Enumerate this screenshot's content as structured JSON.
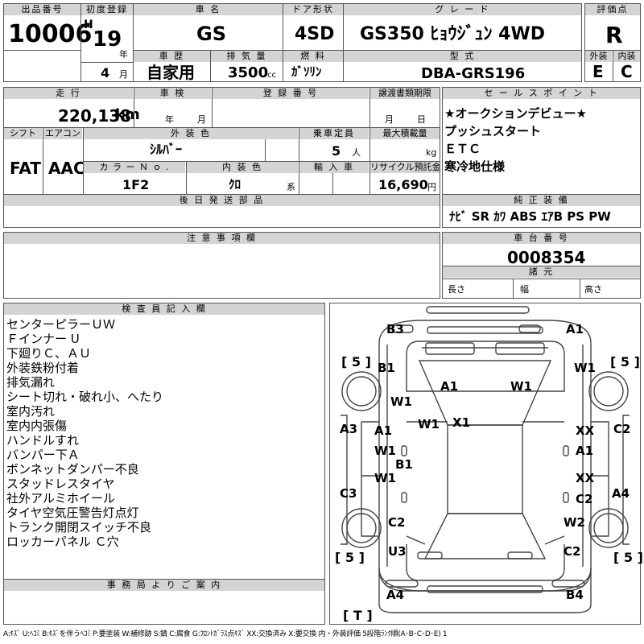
{
  "header": {
    "lot_no_label": "出品番号",
    "lot_no": "10006",
    "first_reg_label": "初度登録",
    "era": "H",
    "year": "19",
    "year_unit": "年",
    "month": "4",
    "month_unit": "月",
    "car_name_label": "車 名",
    "car_name": "GS",
    "door_label": "ドア形状",
    "door": "4SD",
    "grade_label": "グ レ ー ド",
    "grade": "GS350 ﾋｮｳｼﾞｭﾝ 4WD",
    "score_label": "評価点",
    "score": "R",
    "history_label": "車 歴",
    "history": "自家用",
    "displacement_label": "排 気 量",
    "displacement": "3500",
    "displacement_unit": "cc",
    "fuel_label": "燃 料",
    "fuel": "ｶﾞｿﾘﾝ",
    "model_label": "型 式",
    "model": "DBA-GRS196",
    "ext_label": "外装",
    "ext": "E",
    "int_label": "内装",
    "int": "C"
  },
  "details": {
    "mileage_label": "走 行",
    "mileage": "220,138",
    "mileage_unit": "km",
    "inspection_label": "車 検",
    "insp_year": "年",
    "insp_month": "月",
    "regno_label": "登 録 番 号",
    "transfer_label": "譲渡書類期限",
    "tr_month": "月",
    "tr_day": "日",
    "shift_label": "シフト",
    "shift": "FAT",
    "ac_label": "エアコン",
    "ac": "AAC",
    "color_label": "外 装 色",
    "color": "ｼﾙﾊﾞｰ",
    "seats_label": "乗車定員",
    "seats": "5",
    "seats_unit": "人",
    "load_label": "最大積載量",
    "load_unit": "kg",
    "color_no_label": "カ ラ ー Ｎ ｏ .",
    "color_no": "1F2",
    "int_color_label": "内 装 色",
    "int_color": "ｸﾛ",
    "int_color_unit": "系",
    "import_label": "輸 入 車",
    "recycle_label": "リサイクル預託金",
    "recycle": "16,690",
    "recycle_unit": "円",
    "later_parts_label": "後 日 発 送 部 品"
  },
  "sales_points": {
    "label": "セ ー ル ス ポ イ ン ト",
    "items": [
      "★オークションデビュー★",
      "プッシュスタート",
      "ＥＴＣ",
      "寒冷地仕様"
    ]
  },
  "equipment": {
    "label": "純 正 装 備",
    "value": "ﾅﾋﾞ SR ｶﾜ ABS ｴｱB PS PW"
  },
  "notes": {
    "label": "注 意 事 項 欄"
  },
  "chassis": {
    "label": "車 台 番 号",
    "value": "0008354"
  },
  "dims": {
    "label": "諸 元",
    "length": "長さ",
    "width": "幅",
    "height": "高さ"
  },
  "inspector": {
    "label": "検 査 員 記 入 欄",
    "items": [
      "センターピラーＵＷ",
      "Ｆインナー U",
      "下廻りＣ、ＡＵ",
      "外装鉄粉付着",
      "排気漏れ",
      "シート切れ・破れ小、へたり",
      "室内汚れ",
      "室内内張傷",
      "ハンドルすれ",
      "バンパー下Ａ",
      "ボンネットダンパー不良",
      "スタッドレスタイヤ",
      "社外アルミホイール",
      "タイヤ空気圧警告灯点灯",
      "トランク開閉スイッチ不良",
      "ロッカーパネル Ｃ穴"
    ]
  },
  "office": {
    "label": "事 務 局 よ り ご 案 内"
  },
  "legend": "A:ｷｽﾞ U:ﾍｺﾐ B:ｷｽﾞを伴うﾍｺﾐ P:要塗装 W:補修跡 S:錆 C:腐食 G:ﾌﾛﾝﾄｶﾞﾗｽ点ｷｽﾞ XX:交換済み X:要交換 内・外装評価 5段階ﾗﾝｸ順(A･B･C･D･E) 1",
  "diagram": {
    "tire_FL": "[ 5 ]",
    "tire_FR": "[ 5 ]",
    "tire_RL": "[ 5 ]",
    "tire_RR": "[ 5 ]",
    "tire_T": "[ T ]",
    "marks": {
      "front_bumper_L": "B3",
      "front_bumper_R": "A1",
      "fender_FL": "B1",
      "fender_FR": "W1",
      "hood_L": "A1",
      "hood_R": "W1",
      "pillar_FL": "W1",
      "pillar_center_L": "W1",
      "roof": "X1",
      "door_FL": "A1",
      "door_FL2": "W1",
      "rocker_L": "B1",
      "door_RL": "W1",
      "door_FR": "XX",
      "door_FR2": "A1",
      "door_RR": "XX",
      "door_RR2": "C2",
      "side_FL": "A3",
      "side_RL": "C3",
      "side_FR": "C2",
      "side_RR": "A4",
      "fender_RL": "C2",
      "fender_RR": "W2",
      "trunk_L": "U3",
      "trunk_R": "C2",
      "rear_bumper_L": "A4",
      "rear_bumper_R": "B4"
    }
  }
}
